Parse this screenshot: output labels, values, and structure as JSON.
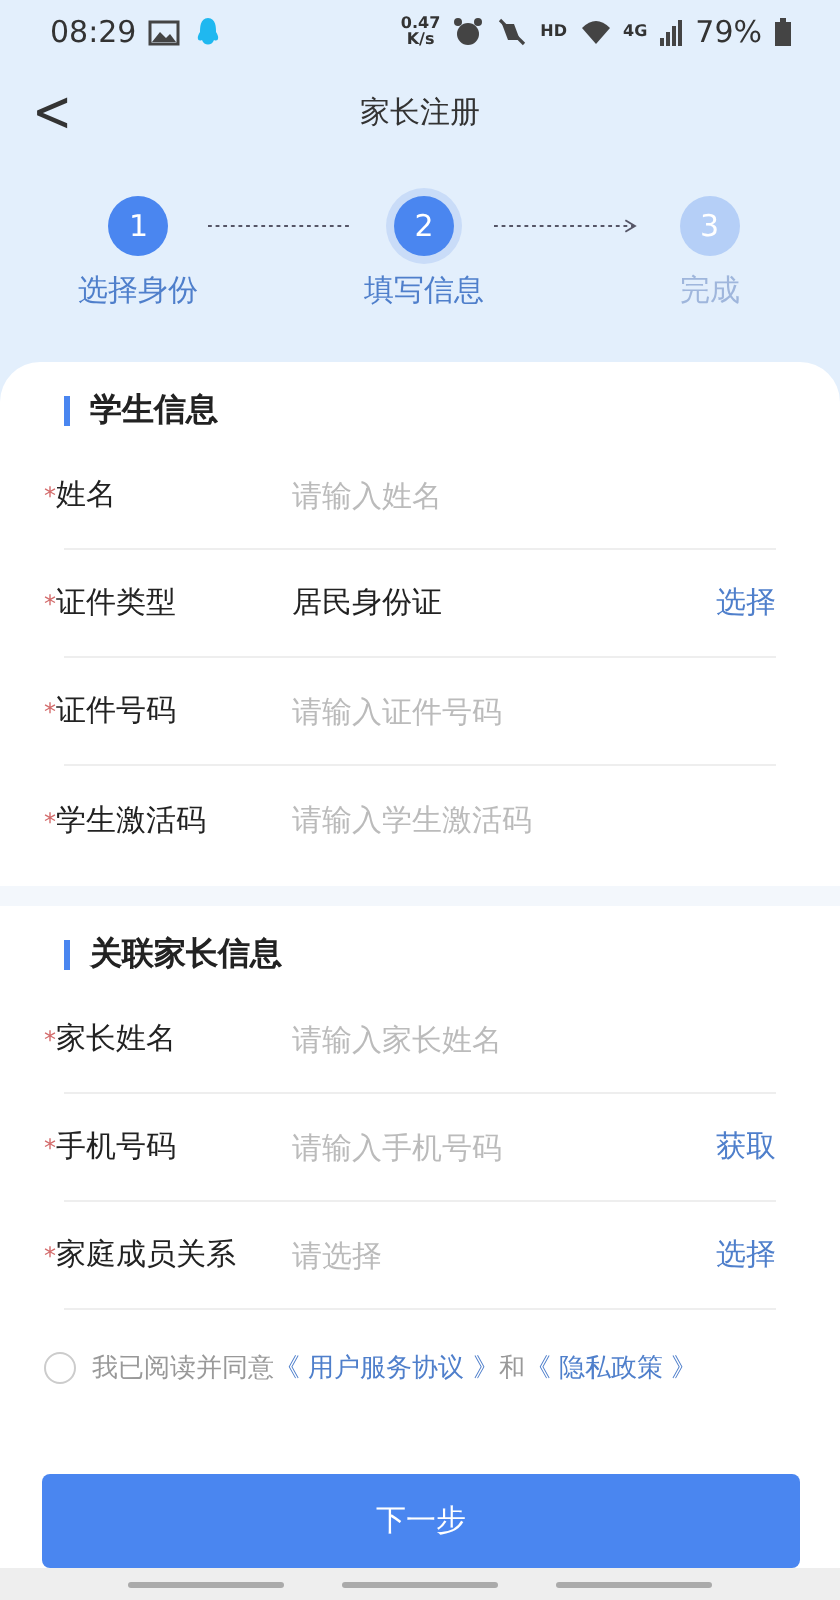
{
  "status_bar": {
    "time": "08:29",
    "speed": "0.47\nK/s",
    "hd": "HD",
    "network": "4G",
    "battery": "79%"
  },
  "header": {
    "back": "<",
    "title": "家长注册"
  },
  "steps": [
    {
      "number": "1",
      "label": "选择身份",
      "done": true,
      "selected": false
    },
    {
      "number": "2",
      "label": "填写信息",
      "done": false,
      "selected": true
    },
    {
      "number": "3",
      "label": "完成",
      "done": false,
      "selected": false
    }
  ],
  "sections": [
    {
      "title": "学生信息",
      "fields": [
        {
          "label": "姓名",
          "required": "*",
          "placeholder": "请输入姓名"
        },
        {
          "label": "证件类型",
          "required": "*",
          "value": "居民身份证",
          "action": "选择"
        },
        {
          "label": "证件号码",
          "required": "*",
          "placeholder": "请输入证件号码"
        },
        {
          "label": "学生激活码",
          "required": "*",
          "placeholder": "请输入学生激活码"
        }
      ]
    },
    {
      "title": "关联家长信息",
      "fields": [
        {
          "label": "家长姓名",
          "required": "*",
          "placeholder": "请输入家长姓名"
        },
        {
          "label": "手机号码",
          "required": "*",
          "placeholder": "请输入手机号码",
          "action": "获取"
        },
        {
          "label": "家庭成员关系",
          "required": "*",
          "placeholder": "请选择",
          "action": "选择"
        }
      ]
    }
  ],
  "agreement": {
    "checked": false,
    "parts": [
      {
        "kind": "text",
        "text": "我已阅读并同意"
      },
      {
        "kind": "link",
        "text": "《 用户服务协议 》"
      },
      {
        "kind": "text",
        "text": "和"
      },
      {
        "kind": "link",
        "text": "《 隐私政策 》"
      }
    ]
  },
  "next_button": "下一步"
}
